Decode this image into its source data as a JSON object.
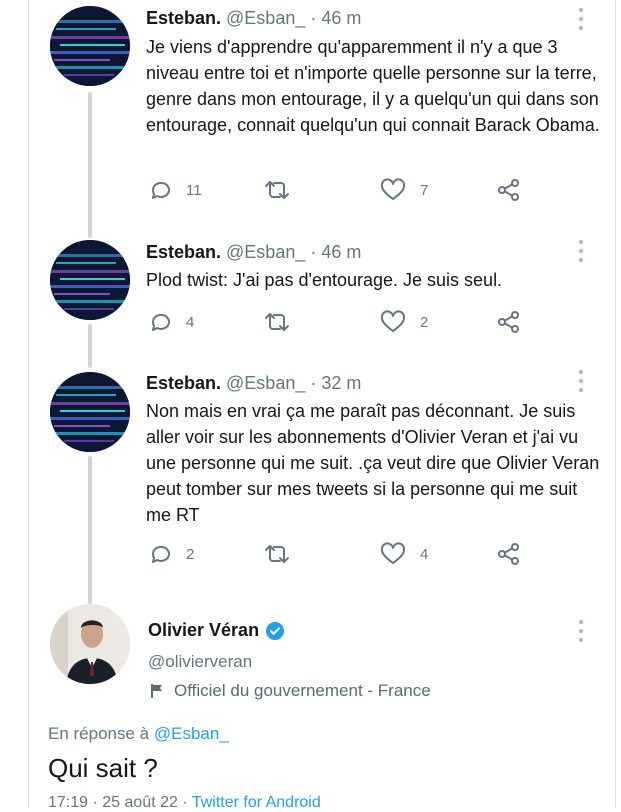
{
  "tweets": [
    {
      "display_name": "Esteban.",
      "meta": " @Esban_ · 46 m",
      "text": "Je viens d'apprendre qu'apparemment il n'y a que 3 niveau entre toi et n'importe quelle personne sur la terre, genre dans mon entourage, il y a quelqu'un qui dans son entourage, connait quelqu'un qui connait Barack Obama.",
      "replies": "11",
      "retweets": "",
      "likes": "7"
    },
    {
      "display_name": "Esteban.",
      "meta": " @Esban_ · 46 m",
      "text": "Plod twist: J'ai pas d'entourage. Je suis seul.",
      "replies": "4",
      "retweets": "",
      "likes": "2"
    },
    {
      "display_name": "Esteban.",
      "meta": " @Esban_ · 32 m",
      "text": "Non mais en vrai ça me paraît pas déconnant. Je suis aller voir sur les abonnements d'Olivier Veran et j'ai vu une personne qui me suit. .ça veut dire que Olivier Veran peut tomber sur mes tweets si la personne qui me suit me RT",
      "replies": "2",
      "retweets": "",
      "likes": "4"
    }
  ],
  "main_tweet": {
    "display_name": "Olivier Véran",
    "handle": "@olivierveran",
    "label": "Officiel du gouvernement - France",
    "reply_prefix": "En réponse à ",
    "reply_handle": "@Esban_",
    "text": "Qui sait ?",
    "timestamp": "17:19 · 25 août 22 · ",
    "source": "Twitter for Android"
  },
  "colors": {
    "link": "#1da1f2",
    "secondary_text": "#66757f",
    "verified": "#1da1f2",
    "thread_line": "#cfd5da"
  },
  "icons": {
    "reply": "reply-bubble-icon",
    "retweet": "retweet-icon",
    "like": "heart-icon",
    "share": "share-icon",
    "more": "more-vertical-icon",
    "verified": "verified-badge-icon",
    "label": "flag-icon"
  }
}
